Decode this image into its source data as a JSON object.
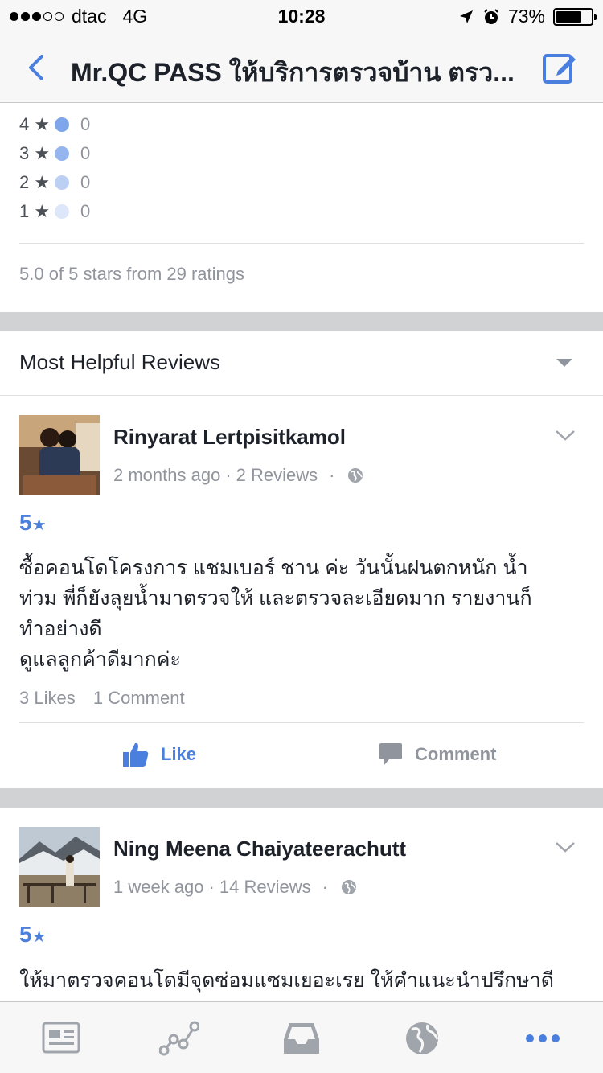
{
  "status_bar": {
    "carrier": "dtac",
    "network": "4G",
    "time": "10:28",
    "battery": "73%",
    "battery_level": 0.73
  },
  "nav": {
    "title": "Mr.QC PASS ให้บริการตรวจบ้าน ตรว..."
  },
  "ratings": {
    "rows": [
      {
        "label": "4",
        "count": "0",
        "color": "#7fa6ea"
      },
      {
        "label": "3",
        "count": "0",
        "color": "#95b5ee"
      },
      {
        "label": "2",
        "count": "0",
        "color": "#bcd0f4"
      },
      {
        "label": "1",
        "count": "0",
        "color": "#dde7f9"
      }
    ],
    "star_glyph": "★",
    "summary": "5.0 of 5 stars from 29 ratings"
  },
  "section": {
    "title": "Most Helpful Reviews"
  },
  "reviews": [
    {
      "name": "Rinyarat Lertpisitkamol",
      "time": "2 months ago",
      "sep": "·",
      "review_count": "2 Reviews",
      "rating": "5",
      "text": "ซื้อคอนโดโครงการ แชมเบอร์ ชาน ค่ะ วันนั้นฝนตกหนัก น้ำ\nท่วม พี่ก็ยังลุยน้ำมาตรวจให้ และตรวจละเอียดมาก รายงานก็\nทำอย่างดี\nดูแลลูกค้าดีมากค่ะ",
      "likes": "3 Likes",
      "comments": "1 Comment"
    },
    {
      "name": "Ning Meena Chaiyateerachutt",
      "time": "1 week ago",
      "sep": "·",
      "review_count": "14 Reviews",
      "rating": "5",
      "text": "ให้มาตรวจคอนโดมีจุดซ่อมแซมเยอะเรย ให้คำแนะนำปรึกษาดี"
    }
  ],
  "actions": {
    "like": "Like",
    "comment": "Comment"
  },
  "colors": {
    "accent": "#4a7fde",
    "muted": "#90949c",
    "text": "#1d2129",
    "band": "#d1d2d4"
  },
  "tab_bar": {
    "icons": [
      "news-feed-icon",
      "insights-icon",
      "inbox-icon",
      "globe-icon",
      "more-icon"
    ]
  }
}
